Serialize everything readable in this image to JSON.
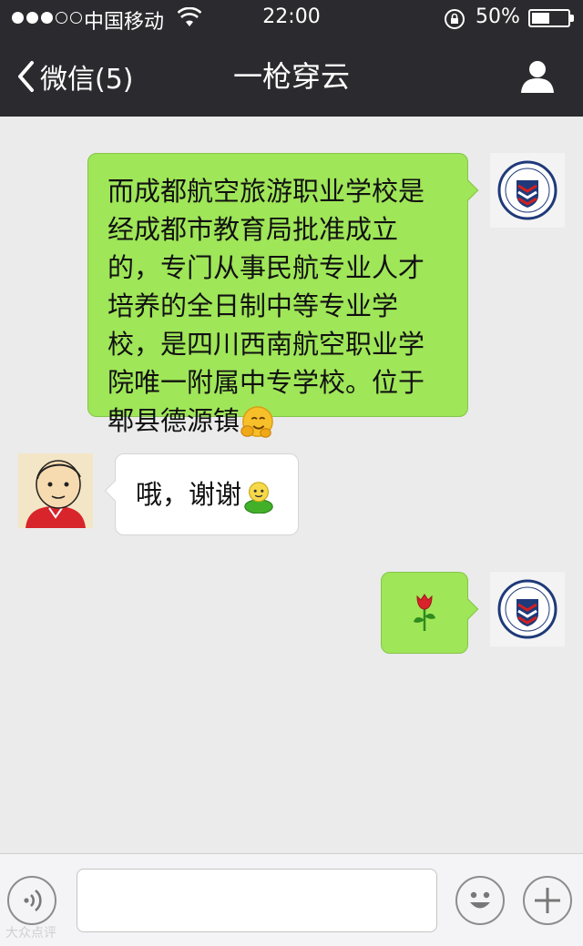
{
  "status_bar": {
    "carrier": "中国移动",
    "time": "22:00",
    "battery_percent": "50%",
    "battery_level": 0.5,
    "signal_strength": 3,
    "signal_max": 5
  },
  "nav": {
    "back_label": "微信(5)",
    "title": "一枪穿云"
  },
  "messages": [
    {
      "sender": "me",
      "text": "而成都航空旅游职业学校是经成都市教育局批准成立的，专门从事民航专业人才培养的全日制中等专业学校，是四川西南航空职业学院唯一附属中专学校。位于郫县德源镇",
      "emoji": "hugging-face"
    },
    {
      "sender": "them",
      "text": "哦，谢谢",
      "emoji": "green-figure"
    },
    {
      "sender": "me",
      "text": "",
      "emoji": "rose"
    }
  ],
  "watermark": "大众点评",
  "colors": {
    "header_bg": "#2b2b2f",
    "chat_bg": "#ebebeb",
    "my_bubble": "#9fe658",
    "their_bubble": "#ffffff"
  }
}
